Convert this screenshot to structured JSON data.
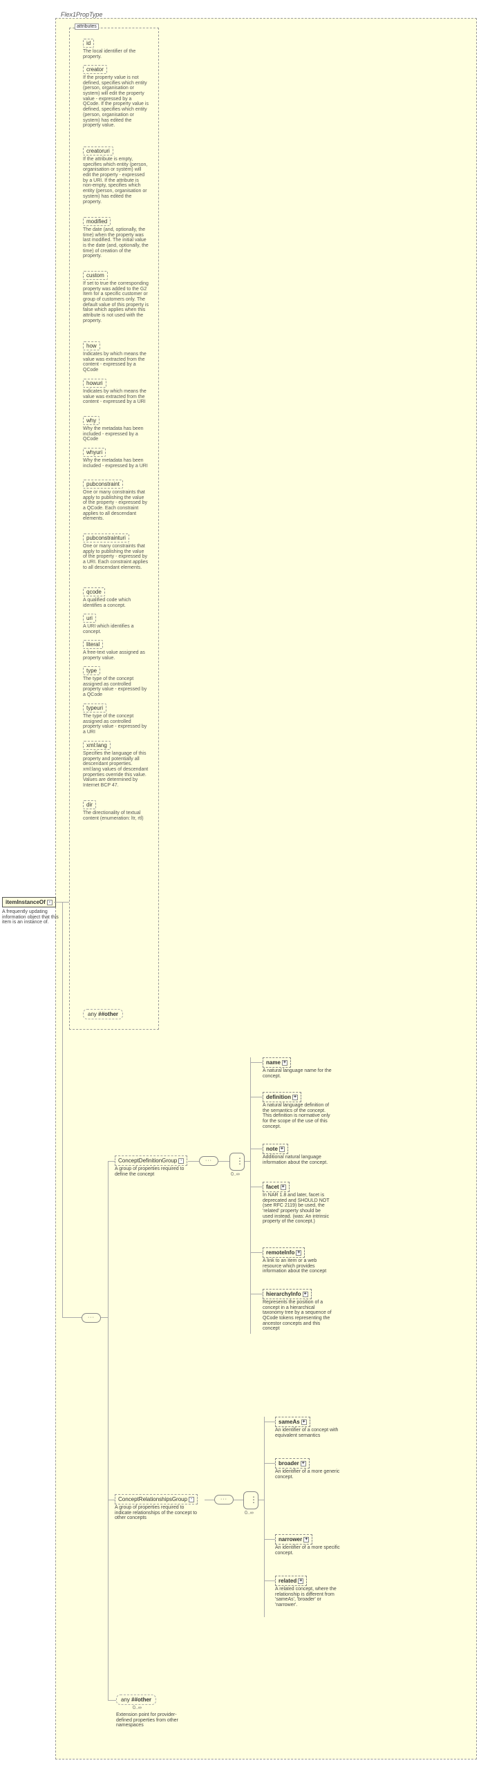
{
  "type_name": "Flex1PropType",
  "root": {
    "name": "itemInstanceOf",
    "desc": "A frequently updating information object that this item is an instance of."
  },
  "attributes_label": "attributes",
  "attributes": [
    {
      "name": "id",
      "desc": "The local identifier of the property."
    },
    {
      "name": "creator",
      "desc": "If the property value is not defined, specifies which entity (person, organisation or system) will edit the property value - expressed by a QCode. If the property value is defined, specifies which entity (person, organisation or system) has edited the property value."
    },
    {
      "name": "creatoruri",
      "desc": "If the attribute is empty, specifies which entity (person, organisation or system) will edit the property - expressed by a URI. If the attribute is non-empty, specifies which entity (person, organisation or system) has edited the property."
    },
    {
      "name": "modified",
      "desc": "The date (and, optionally, the time) when the property was last modified. The initial value is the date (and, optionally, the time) of creation of the property."
    },
    {
      "name": "custom",
      "desc": "If set to true the corresponding property was added to the G2 Item for a specific customer or group of customers only. The default value of this property is false which applies when this attribute is not used with the property."
    },
    {
      "name": "how",
      "desc": "Indicates by which means the value was extracted from the content - expressed by a QCode"
    },
    {
      "name": "howuri",
      "desc": "Indicates by which means the value was extracted from the content - expressed by a URI"
    },
    {
      "name": "why",
      "desc": "Why the metadata has been included - expressed by a QCode"
    },
    {
      "name": "whyuri",
      "desc": "Why the metadata has been included - expressed by a URI"
    },
    {
      "name": "pubconstraint",
      "desc": "One or many constraints that apply to publishing the value of the property - expressed by a QCode. Each constraint applies to all descendant elements."
    },
    {
      "name": "pubconstrainturi",
      "desc": "One or many constraints that apply to publishing the value of the property - expressed by a URI. Each constraint applies to all descendant elements."
    },
    {
      "name": "qcode",
      "desc": "A qualified code which identifies a concept."
    },
    {
      "name": "uri",
      "desc": "A URI which identifies a concept."
    },
    {
      "name": "literal",
      "desc": "A free-text value assigned as property value."
    },
    {
      "name": "type",
      "desc": "The type of the concept assigned as controlled property value - expressed by a QCode"
    },
    {
      "name": "typeuri",
      "desc": "The type of the concept assigned as controlled property value - expressed by a URI"
    },
    {
      "name": "xml:lang",
      "desc": "Specifies the language of this property and potentially all descendant properties. xml:lang values of descendant properties override this value. Values are determined by Internet BCP 47."
    },
    {
      "name": "dir",
      "desc": "The directionality of textual content (enumeration: ltr, rtl)"
    }
  ],
  "any_attr": "##other",
  "groups": {
    "def": {
      "name": "ConceptDefinitionGroup",
      "desc": "A group of properties required to define the concept"
    },
    "rel": {
      "name": "ConceptRelationshipsGroup",
      "desc": "A group of properties required to indicate relationships of the concept to other concepts"
    }
  },
  "def_elements": [
    {
      "name": "name",
      "desc": "A natural language name for the concept."
    },
    {
      "name": "definition",
      "desc": "A natural language definition of the semantics of the concept. This definition is normative only for the scope of the use of this concept."
    },
    {
      "name": "note",
      "desc": "Additional natural language information about the concept."
    },
    {
      "name": "facet",
      "desc": "In NAR 1.8 and later, facet is deprecated and SHOULD NOT (see RFC 2119) be used, the 'related' property should be used instead. (was: An intrinsic property of the concept.)"
    },
    {
      "name": "remoteInfo",
      "desc": "A link to an item or a web resource which provides information about the concept"
    },
    {
      "name": "hierarchyInfo",
      "desc": "Represents the position of a concept in a hierarchical taxonomy tree by a sequence of QCode tokens representing the ancestor concepts and this concept"
    }
  ],
  "rel_elements": [
    {
      "name": "sameAs",
      "desc": "An identifier of a concept with equivalent semantics"
    },
    {
      "name": "broader",
      "desc": "An identifier of a more generic concept."
    },
    {
      "name": "narrower",
      "desc": "An identifier of a more specific concept."
    },
    {
      "name": "related",
      "desc": "A related concept, where the relationship is different from 'sameAs', 'broader' or 'narrower'."
    }
  ],
  "any_elem": {
    "label": "##other",
    "prefix": "any",
    "desc": "Extension point for provider-defined properties from other namespaces"
  },
  "occ_inf": "0..∞"
}
